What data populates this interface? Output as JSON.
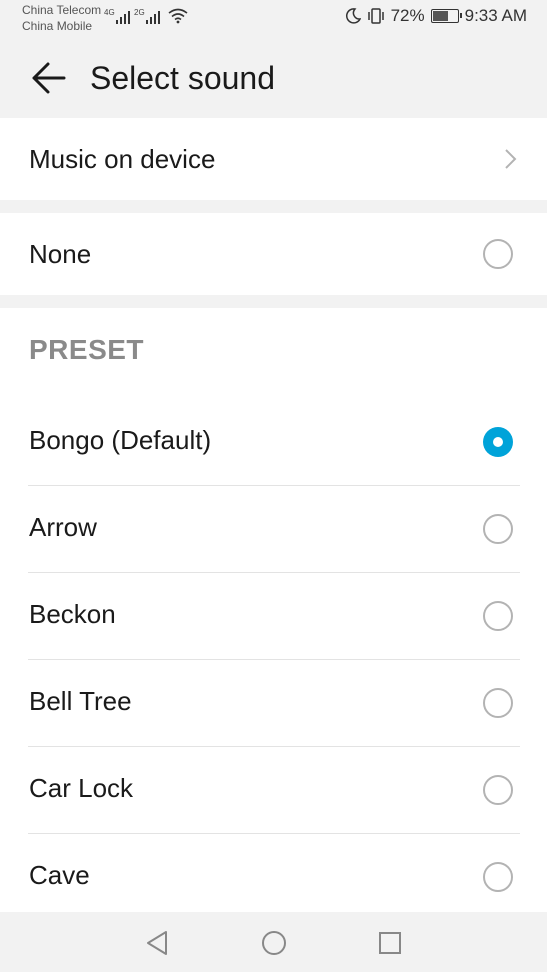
{
  "status_bar": {
    "carrier1": "China Telecom",
    "carrier2": "China Mobile",
    "net1": "4G",
    "net2": "2G",
    "battery": "72%",
    "battery_level": 0.72,
    "time": "9:33 AM"
  },
  "header": {
    "title": "Select sound",
    "back_icon": "arrow-left-icon"
  },
  "music_on_device": {
    "label": "Music on device",
    "icon": "chevron-right-icon"
  },
  "none_option": {
    "label": "None",
    "selected": false
  },
  "preset": {
    "header": "PRESET",
    "items": [
      {
        "label": "Bongo (Default)",
        "selected": true
      },
      {
        "label": "Arrow",
        "selected": false
      },
      {
        "label": "Beckon",
        "selected": false
      },
      {
        "label": "Bell Tree",
        "selected": false
      },
      {
        "label": "Car Lock",
        "selected": false
      },
      {
        "label": "Cave",
        "selected": false
      }
    ]
  },
  "nav_bar": {
    "back": "triangle-back-icon",
    "home": "circle-home-icon",
    "recents": "square-recents-icon"
  },
  "colors": {
    "accent": "#00a3d9",
    "background": "#f2f2f2",
    "card": "#ffffff",
    "section_header": "#8a8a8a"
  }
}
